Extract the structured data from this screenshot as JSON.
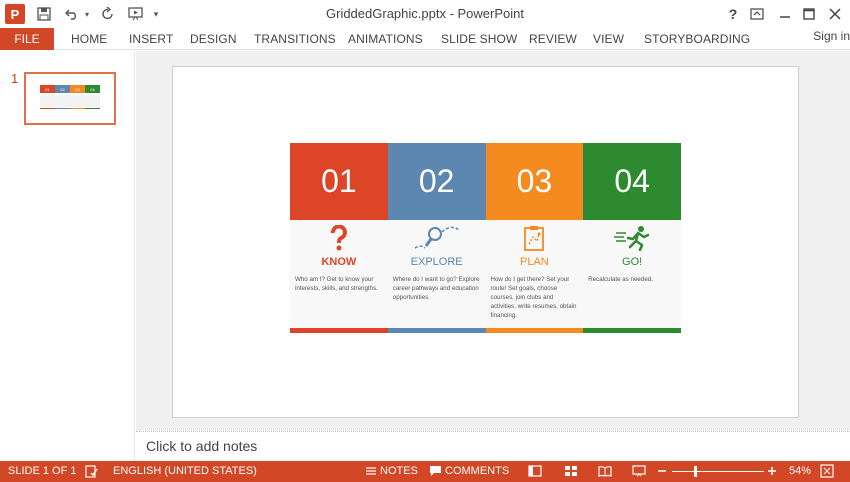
{
  "app": {
    "logo": "P",
    "window_title": "GriddedGraphic.pptx - PowerPoint",
    "help": "?"
  },
  "ribbon": {
    "file": "FILE",
    "tabs": [
      "HOME",
      "INSERT",
      "DESIGN",
      "TRANSITIONS",
      "ANIMATIONS",
      "SLIDE SHOW",
      "REVIEW",
      "VIEW",
      "STORYBOARDING"
    ],
    "sign_in": "Sign in"
  },
  "thumbnails": {
    "slide_number": "1"
  },
  "slide": {
    "columns": [
      {
        "number": "01",
        "title": "KNOW",
        "description": "Who am I? Get to know your interests, skills, and strengths.",
        "color": "#dc4526",
        "icon": "question-mark-icon"
      },
      {
        "number": "02",
        "title": "EXPLORE",
        "description": "Where do I want to go? Explore career pathways and education opportunities.",
        "color": "#5b87b0",
        "icon": "magnifier-path-icon"
      },
      {
        "number": "03",
        "title": "PLAN",
        "description": "How do I get there? Set your route! Set goals, choose courses, join clubs and activities, write resumes, obtain financing.",
        "color": "#f48a20",
        "icon": "clipboard-plan-icon"
      },
      {
        "number": "04",
        "title": "GO!",
        "description": "Recalculate as needed.",
        "color": "#2e8a2e",
        "icon": "running-person-icon"
      }
    ]
  },
  "notes": {
    "placeholder": "Click to add notes"
  },
  "status": {
    "slide_indicator": "SLIDE 1 OF 1",
    "language": "ENGLISH (UNITED STATES)",
    "notes": "NOTES",
    "comments": "COMMENTS",
    "zoom": "54%"
  }
}
